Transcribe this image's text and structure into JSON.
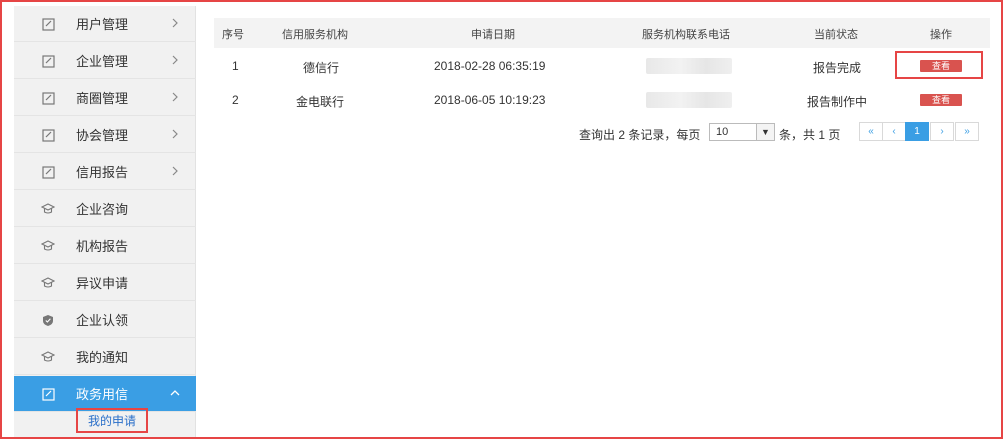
{
  "sidebar": {
    "items": [
      {
        "label": "用户管理",
        "icon": "edit-icon",
        "chevron": "right"
      },
      {
        "label": "企业管理",
        "icon": "edit-icon",
        "chevron": "right"
      },
      {
        "label": "商圈管理",
        "icon": "edit-icon",
        "chevron": "right"
      },
      {
        "label": "协会管理",
        "icon": "edit-icon",
        "chevron": "right"
      },
      {
        "label": "信用报告",
        "icon": "edit-icon",
        "chevron": "right"
      },
      {
        "label": "企业咨询",
        "icon": "graduation-cap-icon"
      },
      {
        "label": "机构报告",
        "icon": "graduation-cap-icon"
      },
      {
        "label": "异议申请",
        "icon": "graduation-cap-icon"
      },
      {
        "label": "企业认领",
        "icon": "shield-icon"
      },
      {
        "label": "我的通知",
        "icon": "graduation-cap-icon"
      },
      {
        "label": "政务用信",
        "icon": "edit-icon",
        "chevron": "up",
        "active": true
      }
    ],
    "sub_item": "我的申请"
  },
  "table": {
    "headers": [
      "序号",
      "信用服务机构",
      "申请日期",
      "服务机构联系电话",
      "当前状态",
      "操作"
    ],
    "rows": [
      {
        "index": "1",
        "agency": "德信行",
        "date": "2018-02-28 06:35:19",
        "status": "报告完成",
        "action": "查看"
      },
      {
        "index": "2",
        "agency": "金电联行",
        "date": "2018-06-05 10:19:23",
        "status": "报告制作中",
        "action": "查看"
      }
    ]
  },
  "pagination": {
    "prefix": "查询出 2 条记录，每页",
    "page_size": "10",
    "suffix": "条，共 1 页",
    "buttons": [
      "«",
      "‹",
      "1",
      "›",
      "»"
    ]
  },
  "colors": {
    "accent": "#3a9ee4",
    "highlight": "#e64545",
    "button": "#d9534f"
  }
}
